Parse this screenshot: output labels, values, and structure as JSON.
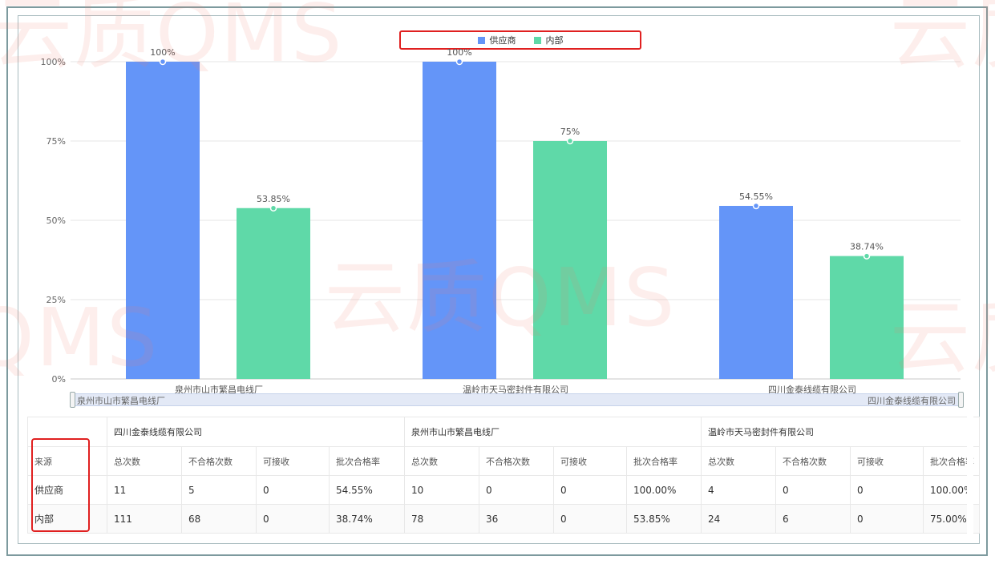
{
  "legend": {
    "items": [
      {
        "label": "供应商",
        "color": "#6495f8"
      },
      {
        "label": "内部",
        "color": "#5fd9a8"
      }
    ]
  },
  "chart_data": {
    "type": "bar",
    "categories": [
      "泉州市山市繁昌电线厂",
      "温岭市天马密封件有限公司",
      "四川金泰线缆有限公司"
    ],
    "series": [
      {
        "name": "供应商",
        "values": [
          100,
          100,
          54.55
        ],
        "labels": [
          "100%",
          "100%",
          "54.55%"
        ],
        "color": "#6495f8"
      },
      {
        "name": "内部",
        "values": [
          53.85,
          75,
          38.74
        ],
        "labels": [
          "53.85%",
          "75%",
          "38.74%"
        ],
        "color": "#5fd9a8"
      }
    ],
    "yticks": [
      "0%",
      "25%",
      "50%",
      "75%",
      "100%"
    ],
    "ylim": [
      0,
      100
    ],
    "grid": true,
    "legend_position": "top-center"
  },
  "datazoom": {
    "start_label": "泉州市山市繁昌电线厂",
    "end_label": "四川金泰线缆有限公司"
  },
  "table": {
    "source_header": "来源",
    "groups": [
      "四川金泰线缆有限公司",
      "泉州市山市繁昌电线厂",
      "温岭市天马密封件有限公司"
    ],
    "columns": [
      "总次数",
      "不合格次数",
      "可接收",
      "批次合格率"
    ],
    "rows": [
      {
        "source": "供应商",
        "cells": [
          "11",
          "5",
          "0",
          "54.55%",
          "10",
          "0",
          "0",
          "100.00%",
          "4",
          "0",
          "0",
          "100.00%"
        ]
      },
      {
        "source": "内部",
        "cells": [
          "111",
          "68",
          "0",
          "38.74%",
          "78",
          "36",
          "0",
          "53.85%",
          "24",
          "6",
          "0",
          "75.00%"
        ]
      }
    ]
  },
  "watermark": {
    "text": "云质QMS"
  }
}
